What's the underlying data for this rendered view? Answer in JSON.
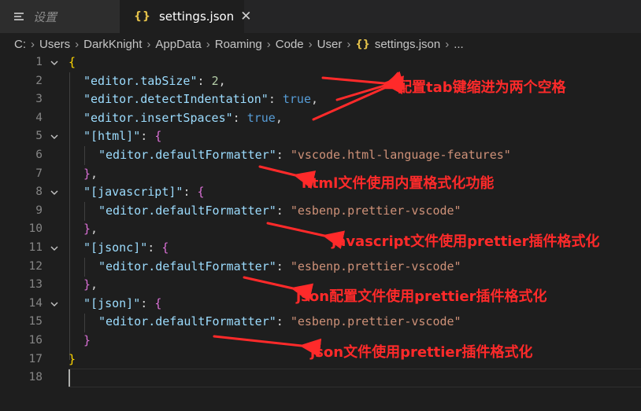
{
  "tabs": [
    {
      "label": "设置",
      "icon": "hamburger-menu-icon"
    },
    {
      "label": "settings.json",
      "icon": "json-braces-icon",
      "close_glyph": "✕"
    }
  ],
  "breadcrumb": {
    "items": [
      "C:",
      "Users",
      "DarkKnight",
      "AppData",
      "Roaming",
      "Code",
      "User"
    ],
    "file": "settings.json",
    "more": "...",
    "file_icon_glyph": "{}",
    "separator": "›"
  },
  "editor": {
    "lines": [
      {
        "n": "1"
      },
      {
        "n": "2"
      },
      {
        "n": "3"
      },
      {
        "n": "4"
      },
      {
        "n": "5"
      },
      {
        "n": "6"
      },
      {
        "n": "7"
      },
      {
        "n": "8"
      },
      {
        "n": "9"
      },
      {
        "n": "10"
      },
      {
        "n": "11"
      },
      {
        "n": "12"
      },
      {
        "n": "13"
      },
      {
        "n": "14"
      },
      {
        "n": "15"
      },
      {
        "n": "16"
      },
      {
        "n": "17"
      },
      {
        "n": "18"
      }
    ],
    "tokens": {
      "open_root": "{",
      "close_root": "}",
      "tab_size_key": "\"editor.tabSize\"",
      "tab_size_val": "2",
      "detect_key": "\"editor.detectIndentation\"",
      "detect_val": "true",
      "insert_key": "\"editor.insertSpaces\"",
      "insert_val": "true",
      "html_key": "\"[html]\"",
      "javascript_key": "\"[javascript]\"",
      "jsonc_key": "\"[jsonc]\"",
      "json_key": "\"[json]\"",
      "formatter_key": "\"editor.defaultFormatter\"",
      "html_formatter": "\"vscode.html-language-features\"",
      "prettier_formatter": "\"esbenp.prettier-vscode\"",
      "open_obj": "{",
      "close_obj": "}",
      "colon": ": ",
      "comma": ","
    }
  },
  "annotations": [
    {
      "text": "配置tab键缩进为两个空格"
    },
    {
      "text": "html文件使用内置格式化功能"
    },
    {
      "text": "javascript文件使用prettier插件格式化"
    },
    {
      "text": "json配置文件使用prettier插件格式化"
    },
    {
      "text": "json文件使用prettier插件格式化"
    }
  ],
  "colors": {
    "annotation": "#ff2a2a",
    "key": "#9cdcfe",
    "string": "#ce9178",
    "number": "#b5cea8",
    "boolean": "#569cd6",
    "bracket_level1": "#ffd700",
    "bracket_level2": "#da70d6",
    "background": "#1e1e1e"
  }
}
